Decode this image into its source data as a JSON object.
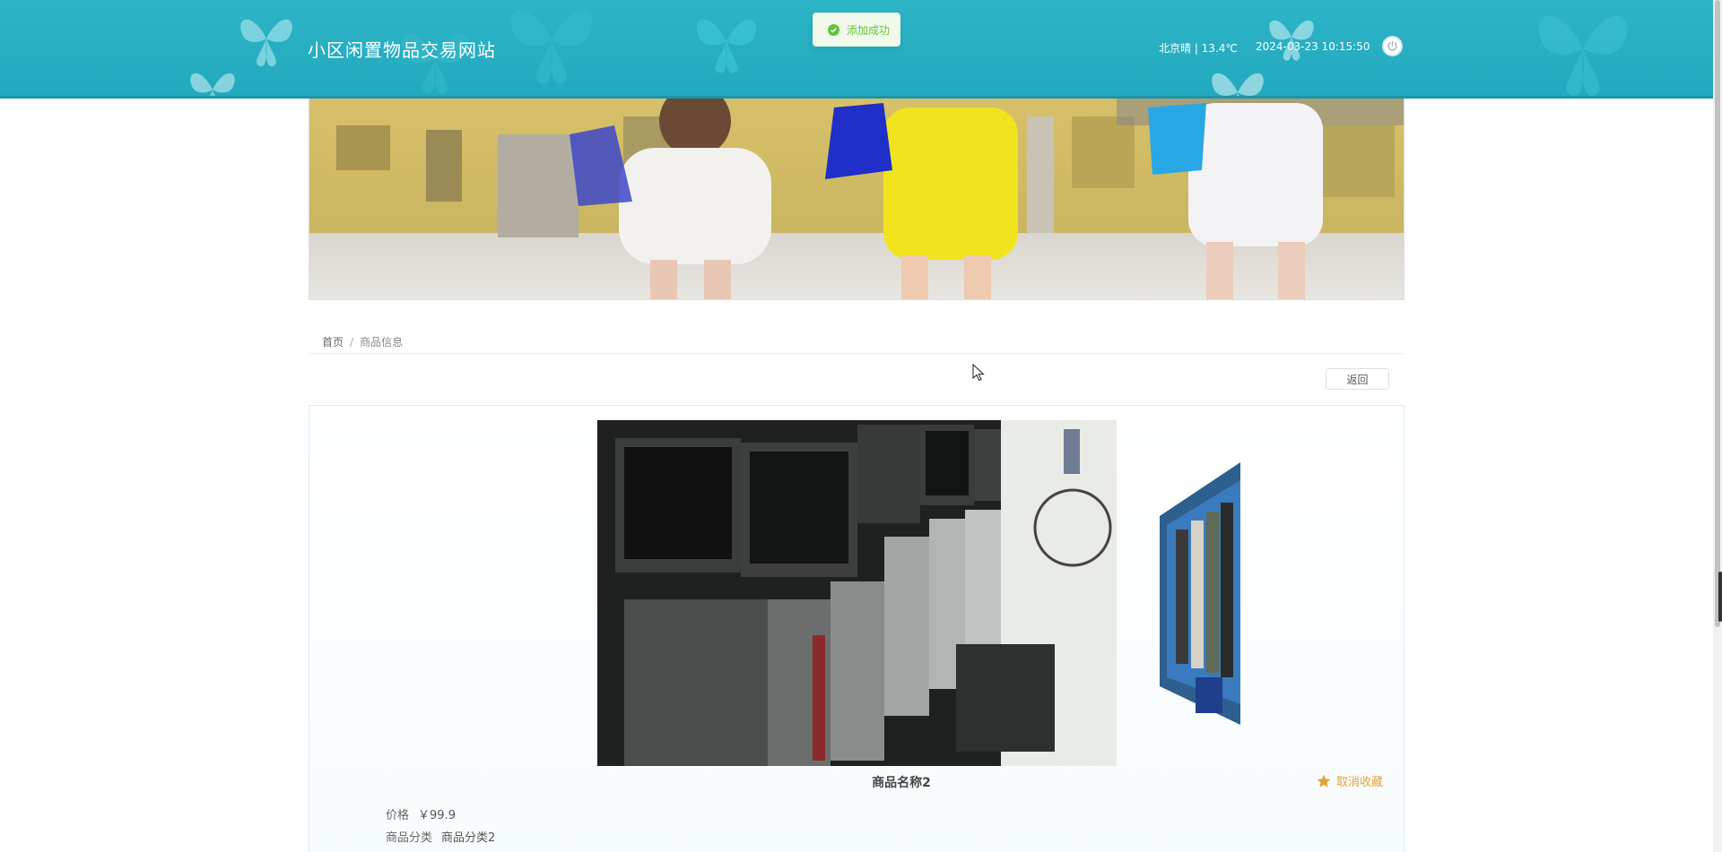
{
  "header": {
    "site_title": "小区闲置物品交易网站",
    "weather": "北京晴 | 13.4℃",
    "datetime": "2024-03-23   10:15:50",
    "power_icon": "power-icon"
  },
  "toast": {
    "message": "添加成功",
    "icon": "check-circle-icon",
    "color": "#67c23a"
  },
  "breadcrumb": {
    "home": "首页",
    "separator": "/",
    "current": "商品信息"
  },
  "actions": {
    "back_label": "返回"
  },
  "product": {
    "name": "商品名称2",
    "favorite_label": "取消收藏",
    "favorite_icon": "star-icon",
    "price_label": "价格",
    "price_value": "￥99.9",
    "category_label": "商品分类",
    "category_value": "商品分类2"
  },
  "colors": {
    "header_bg": "#22a9bd",
    "accent": "#e6a23c",
    "success": "#67c23a"
  }
}
